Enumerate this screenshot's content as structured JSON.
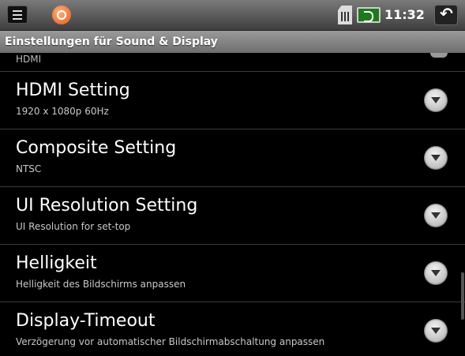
{
  "statusbar": {
    "time": "11:32",
    "icons": [
      "notification-icon",
      "app-icon",
      "sim-icon",
      "battery-icon",
      "back-icon"
    ]
  },
  "title": "Einstellungen für Sound & Display",
  "partial_item": {
    "subtitle": "HDMI"
  },
  "items": [
    {
      "title": "HDMI Setting",
      "subtitle": "1920 x 1080p 60Hz"
    },
    {
      "title": "Composite Setting",
      "subtitle": "NTSC"
    },
    {
      "title": "UI Resolution Setting",
      "subtitle": "UI Resolution for set-top"
    },
    {
      "title": "Helligkeit",
      "subtitle": "Helligkeit des Bildschirms anpassen"
    },
    {
      "title": "Display-Timeout",
      "subtitle": "Verzögerung vor automatischer Bildschirmabschaltung anpassen"
    }
  ],
  "colors": {
    "background": "#000000",
    "titlebar": "#8a8a8a",
    "text": "#ffffff",
    "subtext": "#c8c8c8"
  }
}
